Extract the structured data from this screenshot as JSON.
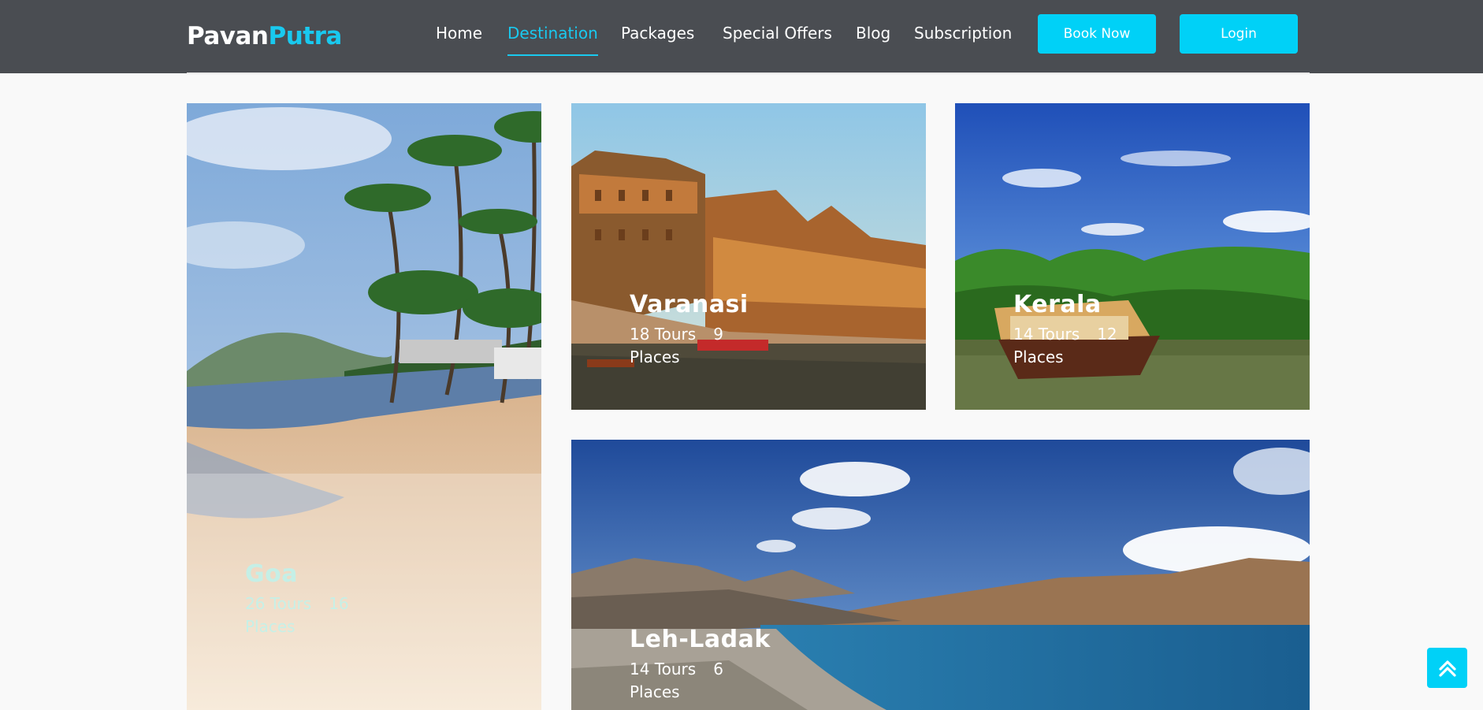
{
  "brand": {
    "part1": "Pavan",
    "part2": "Putra",
    "accent_color": "#19c9ef"
  },
  "nav": {
    "items": [
      {
        "label": "Home",
        "active": false
      },
      {
        "label": "Destination",
        "active": true
      },
      {
        "label": "Packages",
        "active": false
      },
      {
        "label": "Special Offers",
        "active": false
      },
      {
        "label": "Blog",
        "active": false
      },
      {
        "label": "Subscription",
        "active": false
      }
    ],
    "book_now": "Book Now",
    "login": "Login"
  },
  "destinations": [
    {
      "name": "Goa",
      "tours": "26 Tours",
      "places": "16",
      "places_label": "Places"
    },
    {
      "name": "Varanasi",
      "tours": "18 Tours",
      "places": "9",
      "places_label": "Places"
    },
    {
      "name": "Kerala",
      "tours": "14 Tours",
      "places": "12",
      "places_label": "Places"
    },
    {
      "name": "Leh-Ladak",
      "tours": "14 Tours",
      "places": "6",
      "places_label": "Places"
    }
  ],
  "icons": {
    "scroll_top": "double-chevron-up-icon"
  },
  "colors": {
    "header_bg": "#4a4d52",
    "button_bg": "#00d1f7",
    "page_bg": "#f9f9f9"
  }
}
